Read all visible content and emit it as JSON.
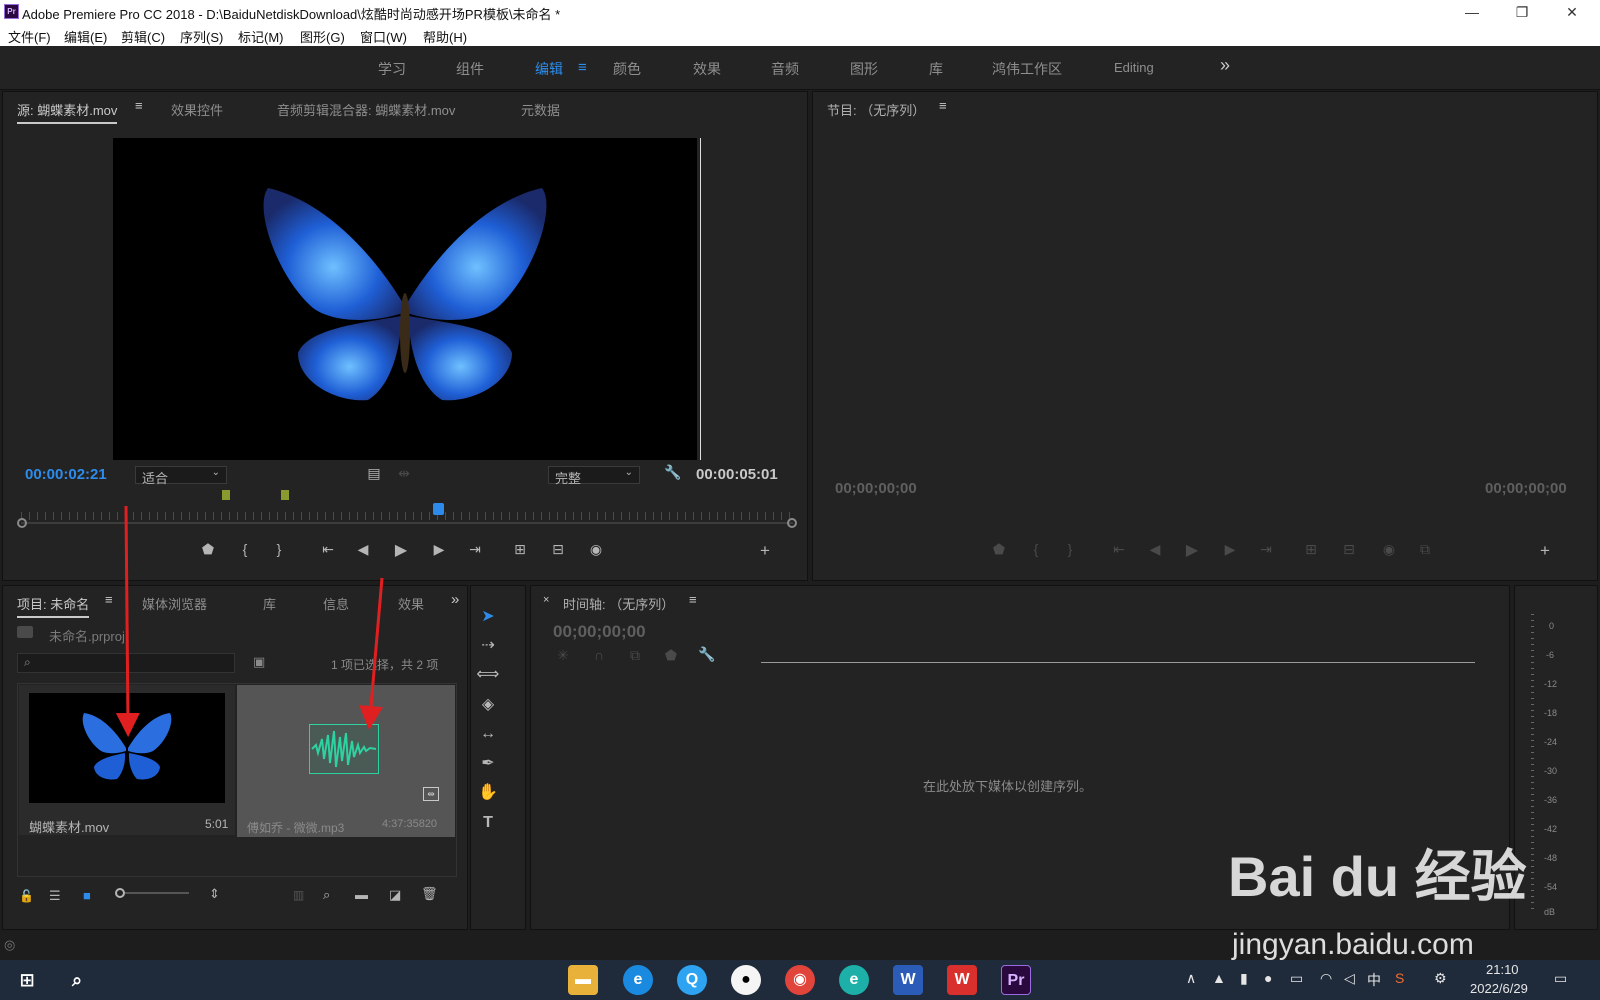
{
  "window": {
    "title": "Adobe Premiere Pro CC 2018 - D:\\BaiduNetdiskDownload\\炫酷时尚动感开场PR模板\\未命名 *",
    "app_icon": "Pr",
    "controls": {
      "minimize": "—",
      "restore": "❐",
      "close": "✕"
    }
  },
  "menu": [
    "文件(F)",
    "编辑(E)",
    "剪辑(C)",
    "序列(S)",
    "标记(M)",
    "图形(G)",
    "窗口(W)",
    "帮助(H)"
  ],
  "workspaces": {
    "items": [
      "学习",
      "组件",
      "编辑",
      "颜色",
      "效果",
      "音频",
      "图形",
      "库",
      "鸿伟工作区",
      "Editing"
    ],
    "active": "编辑",
    "more": "»"
  },
  "source_panel": {
    "tabs": [
      "源: 蝴蝶素材.mov",
      "效果控件",
      "音频剪辑混合器: 蝴蝶素材.mov",
      "元数据"
    ],
    "timecode": "00:00:02:21",
    "zoom": "适合",
    "quality": "完整",
    "duration": "00:00:05:01",
    "playhead_fraction": 0.54
  },
  "program_panel": {
    "title": "节目: （无序列）",
    "timecode_left": "00;00;00;00",
    "timecode_right": "00;00;00;00"
  },
  "project_panel": {
    "tabs": [
      "项目: 未命名",
      "媒体浏览器",
      "库",
      "信息",
      "效果"
    ],
    "file": "未命名.prproj",
    "status": "1 项已选择，共 2 项",
    "items": [
      {
        "name": "蝴蝶素材.mov",
        "duration": "5:01"
      },
      {
        "name": "傅如乔 - 微微.mp3",
        "duration": "4:37:35820"
      }
    ]
  },
  "timeline_panel": {
    "title": "时间轴: （无序列）",
    "timecode": "00;00;00;00",
    "empty_message": "在此处放下媒体以创建序列。"
  },
  "audio_meter": {
    "labels": [
      "0",
      "-6",
      "-12",
      "-18",
      "-24",
      "-30",
      "-36",
      "-42",
      "-48",
      "-54",
      "dB"
    ]
  },
  "watermark": {
    "brand": "Bai du 经验",
    "url": "jingyan.baidu.com"
  },
  "taskbar": {
    "tray_ime": "中",
    "time": "21:10",
    "date": "2022/6/29"
  },
  "colors": {
    "accent_blue": "#2d8ceb",
    "panel_bg": "#232323",
    "marker_green": "#8a9a2e",
    "audio_green": "#2ed1a0",
    "arrow_red": "#e02020"
  }
}
